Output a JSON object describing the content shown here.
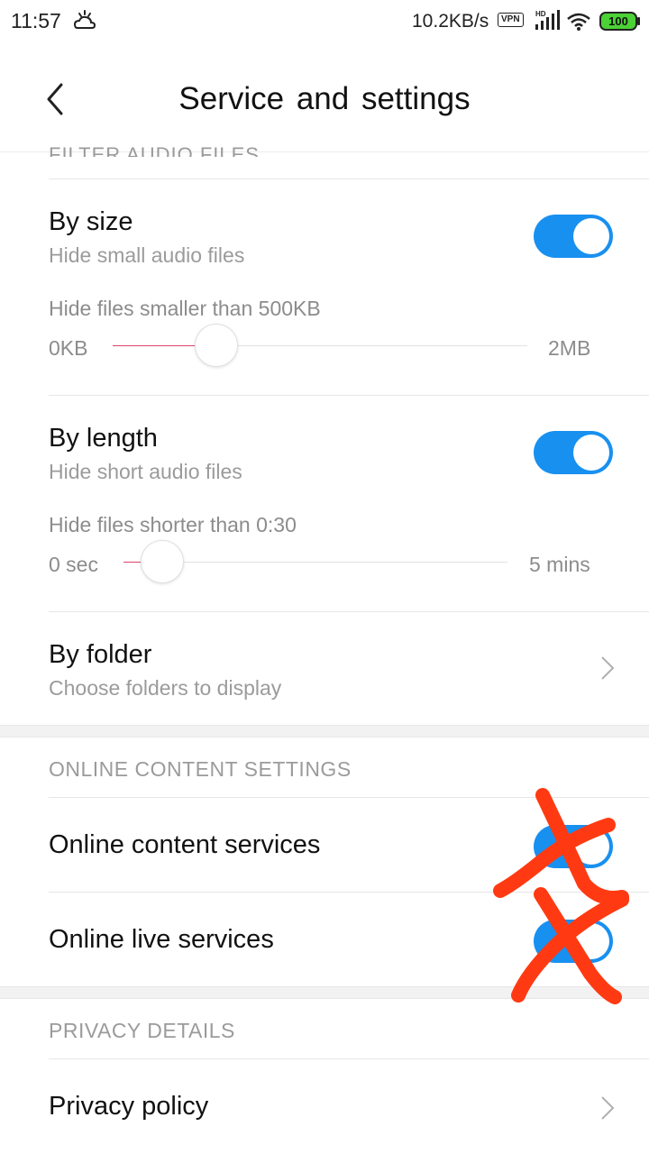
{
  "status_bar": {
    "time": "11:57",
    "network_speed": "10.2KB/s",
    "vpn_label": "VPN",
    "signal_label": "HD",
    "battery": "100",
    "icons": [
      "weather-icon",
      "vpn-icon",
      "signal-icon",
      "wifi-icon",
      "battery-icon"
    ]
  },
  "header": {
    "title": "Service  and  settings",
    "back_icon": "back-arrow-icon"
  },
  "filter_section": {
    "cut_off_heading": "FILTER AUDIO FILES",
    "by_size": {
      "title": "By size",
      "subtitle": "Hide small audio files",
      "enabled": true,
      "slider_caption": "Hide files smaller than 500KB",
      "min_label": "0KB",
      "max_label": "2MB",
      "value_fraction": 0.25
    },
    "by_length": {
      "title": "By length",
      "subtitle": "Hide short audio files",
      "enabled": true,
      "slider_caption": "Hide files shorter than 0:30",
      "min_label": "0 sec",
      "max_label": "5 mins",
      "value_fraction": 0.1
    },
    "by_folder": {
      "title": "By folder",
      "subtitle": "Choose folders to display"
    }
  },
  "online_section": {
    "heading": "ONLINE CONTENT SETTINGS",
    "items": [
      {
        "label": "Online content services",
        "enabled": true
      },
      {
        "label": "Online live services",
        "enabled": true
      }
    ]
  },
  "privacy_section": {
    "heading": "PRIVACY DETAILS",
    "items": [
      {
        "label": "Privacy policy"
      }
    ]
  },
  "colors": {
    "toggle_on": "#1890f0",
    "slider_fill": "#e0446a",
    "scribble": "#ff3a12"
  }
}
